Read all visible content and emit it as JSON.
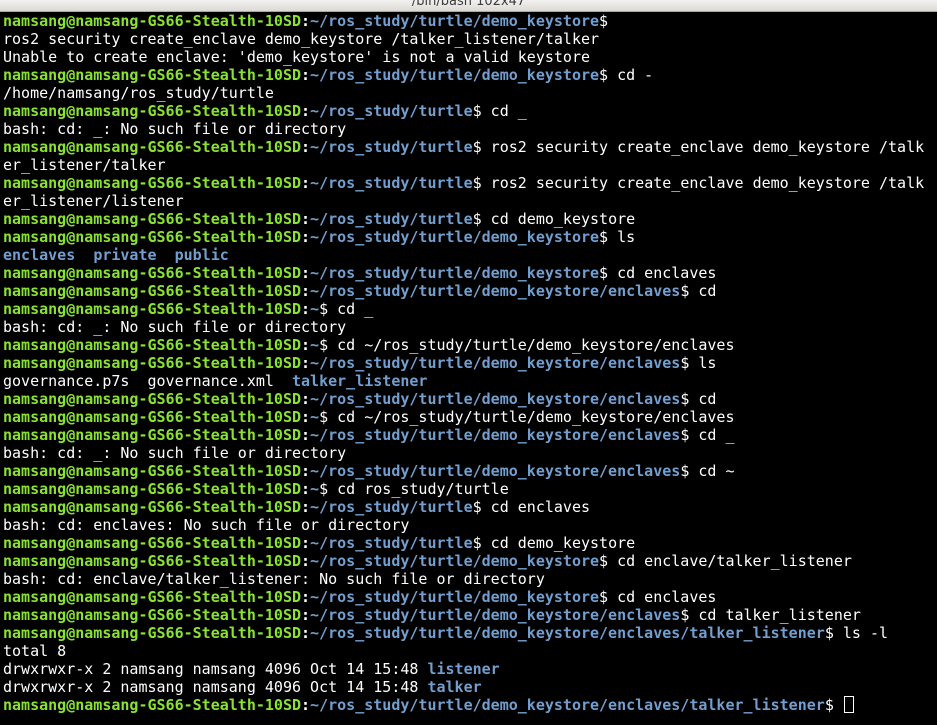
{
  "window": {
    "title": "/bin/bash 102x47"
  },
  "terminal": {
    "lines": [
      {
        "type": "prompt",
        "user": "namsang@namsang-GS66-Stealth-10SD",
        "path": "~/ros_study/turtle/demo_keystore",
        "cmd": ""
      },
      {
        "type": "text",
        "text": "ros2 security create_enclave demo_keystore /talker_listener/talker"
      },
      {
        "type": "text",
        "text": "Unable to create enclave: 'demo_keystore' is not a valid keystore"
      },
      {
        "type": "prompt",
        "user": "namsang@namsang-GS66-Stealth-10SD",
        "path": "~/ros_study/turtle/demo_keystore",
        "cmd": " cd -"
      },
      {
        "type": "text",
        "text": "/home/namsang/ros_study/turtle"
      },
      {
        "type": "prompt",
        "user": "namsang@namsang-GS66-Stealth-10SD",
        "path": "~/ros_study/turtle",
        "cmd": " cd _"
      },
      {
        "type": "text",
        "text": "bash: cd: _: No such file or directory"
      },
      {
        "type": "prompt",
        "user": "namsang@namsang-GS66-Stealth-10SD",
        "path": "~/ros_study/turtle",
        "cmd": " ros2 security create_enclave demo_keystore /talk"
      },
      {
        "type": "text",
        "text": "er_listener/talker"
      },
      {
        "type": "prompt",
        "user": "namsang@namsang-GS66-Stealth-10SD",
        "path": "~/ros_study/turtle",
        "cmd": " ros2 security create_enclave demo_keystore /talk"
      },
      {
        "type": "text",
        "text": "er_listener/listener"
      },
      {
        "type": "prompt",
        "user": "namsang@namsang-GS66-Stealth-10SD",
        "path": "~/ros_study/turtle",
        "cmd": " cd demo_keystore"
      },
      {
        "type": "prompt",
        "user": "namsang@namsang-GS66-Stealth-10SD",
        "path": "~/ros_study/turtle/demo_keystore",
        "cmd": " ls"
      },
      {
        "type": "listing",
        "entries": [
          {
            "name": "enclaves",
            "kind": "dir"
          },
          {
            "name": "  ",
            "kind": "gap"
          },
          {
            "name": "private",
            "kind": "dir"
          },
          {
            "name": "  ",
            "kind": "gap"
          },
          {
            "name": "public",
            "kind": "dir"
          }
        ]
      },
      {
        "type": "prompt",
        "user": "namsang@namsang-GS66-Stealth-10SD",
        "path": "~/ros_study/turtle/demo_keystore",
        "cmd": " cd enclaves"
      },
      {
        "type": "prompt",
        "user": "namsang@namsang-GS66-Stealth-10SD",
        "path": "~/ros_study/turtle/demo_keystore/enclaves",
        "cmd": " cd"
      },
      {
        "type": "prompt",
        "user": "namsang@namsang-GS66-Stealth-10SD",
        "path": "~",
        "cmd": " cd _"
      },
      {
        "type": "text",
        "text": "bash: cd: _: No such file or directory"
      },
      {
        "type": "prompt",
        "user": "namsang@namsang-GS66-Stealth-10SD",
        "path": "~",
        "cmd": " cd ~/ros_study/turtle/demo_keystore/enclaves"
      },
      {
        "type": "prompt",
        "user": "namsang@namsang-GS66-Stealth-10SD",
        "path": "~/ros_study/turtle/demo_keystore/enclaves",
        "cmd": " ls"
      },
      {
        "type": "listing",
        "entries": [
          {
            "name": "governance.p7s",
            "kind": "file"
          },
          {
            "name": "  ",
            "kind": "gap"
          },
          {
            "name": "governance.xml",
            "kind": "file"
          },
          {
            "name": "  ",
            "kind": "gap"
          },
          {
            "name": "talker_listener",
            "kind": "dir"
          }
        ]
      },
      {
        "type": "prompt",
        "user": "namsang@namsang-GS66-Stealth-10SD",
        "path": "~/ros_study/turtle/demo_keystore/enclaves",
        "cmd": " cd"
      },
      {
        "type": "prompt",
        "user": "namsang@namsang-GS66-Stealth-10SD",
        "path": "~",
        "cmd": " cd ~/ros_study/turtle/demo_keystore/enclaves"
      },
      {
        "type": "prompt",
        "user": "namsang@namsang-GS66-Stealth-10SD",
        "path": "~/ros_study/turtle/demo_keystore/enclaves",
        "cmd": " cd _"
      },
      {
        "type": "text",
        "text": "bash: cd: _: No such file or directory"
      },
      {
        "type": "prompt",
        "user": "namsang@namsang-GS66-Stealth-10SD",
        "path": "~/ros_study/turtle/demo_keystore/enclaves",
        "cmd": " cd ~"
      },
      {
        "type": "prompt",
        "user": "namsang@namsang-GS66-Stealth-10SD",
        "path": "~",
        "cmd": " cd ros_study/turtle"
      },
      {
        "type": "prompt",
        "user": "namsang@namsang-GS66-Stealth-10SD",
        "path": "~/ros_study/turtle",
        "cmd": " cd enclaves"
      },
      {
        "type": "text",
        "text": "bash: cd: enclaves: No such file or directory"
      },
      {
        "type": "prompt",
        "user": "namsang@namsang-GS66-Stealth-10SD",
        "path": "~/ros_study/turtle",
        "cmd": " cd demo_keystore"
      },
      {
        "type": "prompt",
        "user": "namsang@namsang-GS66-Stealth-10SD",
        "path": "~/ros_study/turtle/demo_keystore",
        "cmd": " cd enclave/talker_listener"
      },
      {
        "type": "text",
        "text": "bash: cd: enclave/talker_listener: No such file or directory"
      },
      {
        "type": "prompt",
        "user": "namsang@namsang-GS66-Stealth-10SD",
        "path": "~/ros_study/turtle/demo_keystore",
        "cmd": " cd enclaves"
      },
      {
        "type": "prompt",
        "user": "namsang@namsang-GS66-Stealth-10SD",
        "path": "~/ros_study/turtle/demo_keystore/enclaves",
        "cmd": " cd talker_listener"
      },
      {
        "type": "prompt",
        "user": "namsang@namsang-GS66-Stealth-10SD",
        "path": "~/ros_study/turtle/demo_keystore/enclaves/talker_listener",
        "cmd": " ls -l"
      },
      {
        "type": "text",
        "text": "total 8"
      },
      {
        "type": "listing",
        "entries": [
          {
            "name": "drwxrwxr-x 2 namsang namsang 4096 Oct 14 15:48 ",
            "kind": "file"
          },
          {
            "name": "listener",
            "kind": "dir"
          }
        ]
      },
      {
        "type": "listing",
        "entries": [
          {
            "name": "drwxrwxr-x 2 namsang namsang 4096 Oct 14 15:48 ",
            "kind": "file"
          },
          {
            "name": "talker",
            "kind": "dir"
          }
        ]
      },
      {
        "type": "prompt",
        "user": "namsang@namsang-GS66-Stealth-10SD",
        "path": "~/ros_study/turtle/demo_keystore/enclaves/talker_listener",
        "cmd": " ",
        "cursor": true
      }
    ]
  },
  "colors": {
    "background": "#000000",
    "user": "#8ae234",
    "path": "#729fcf",
    "text": "#ffffff"
  }
}
